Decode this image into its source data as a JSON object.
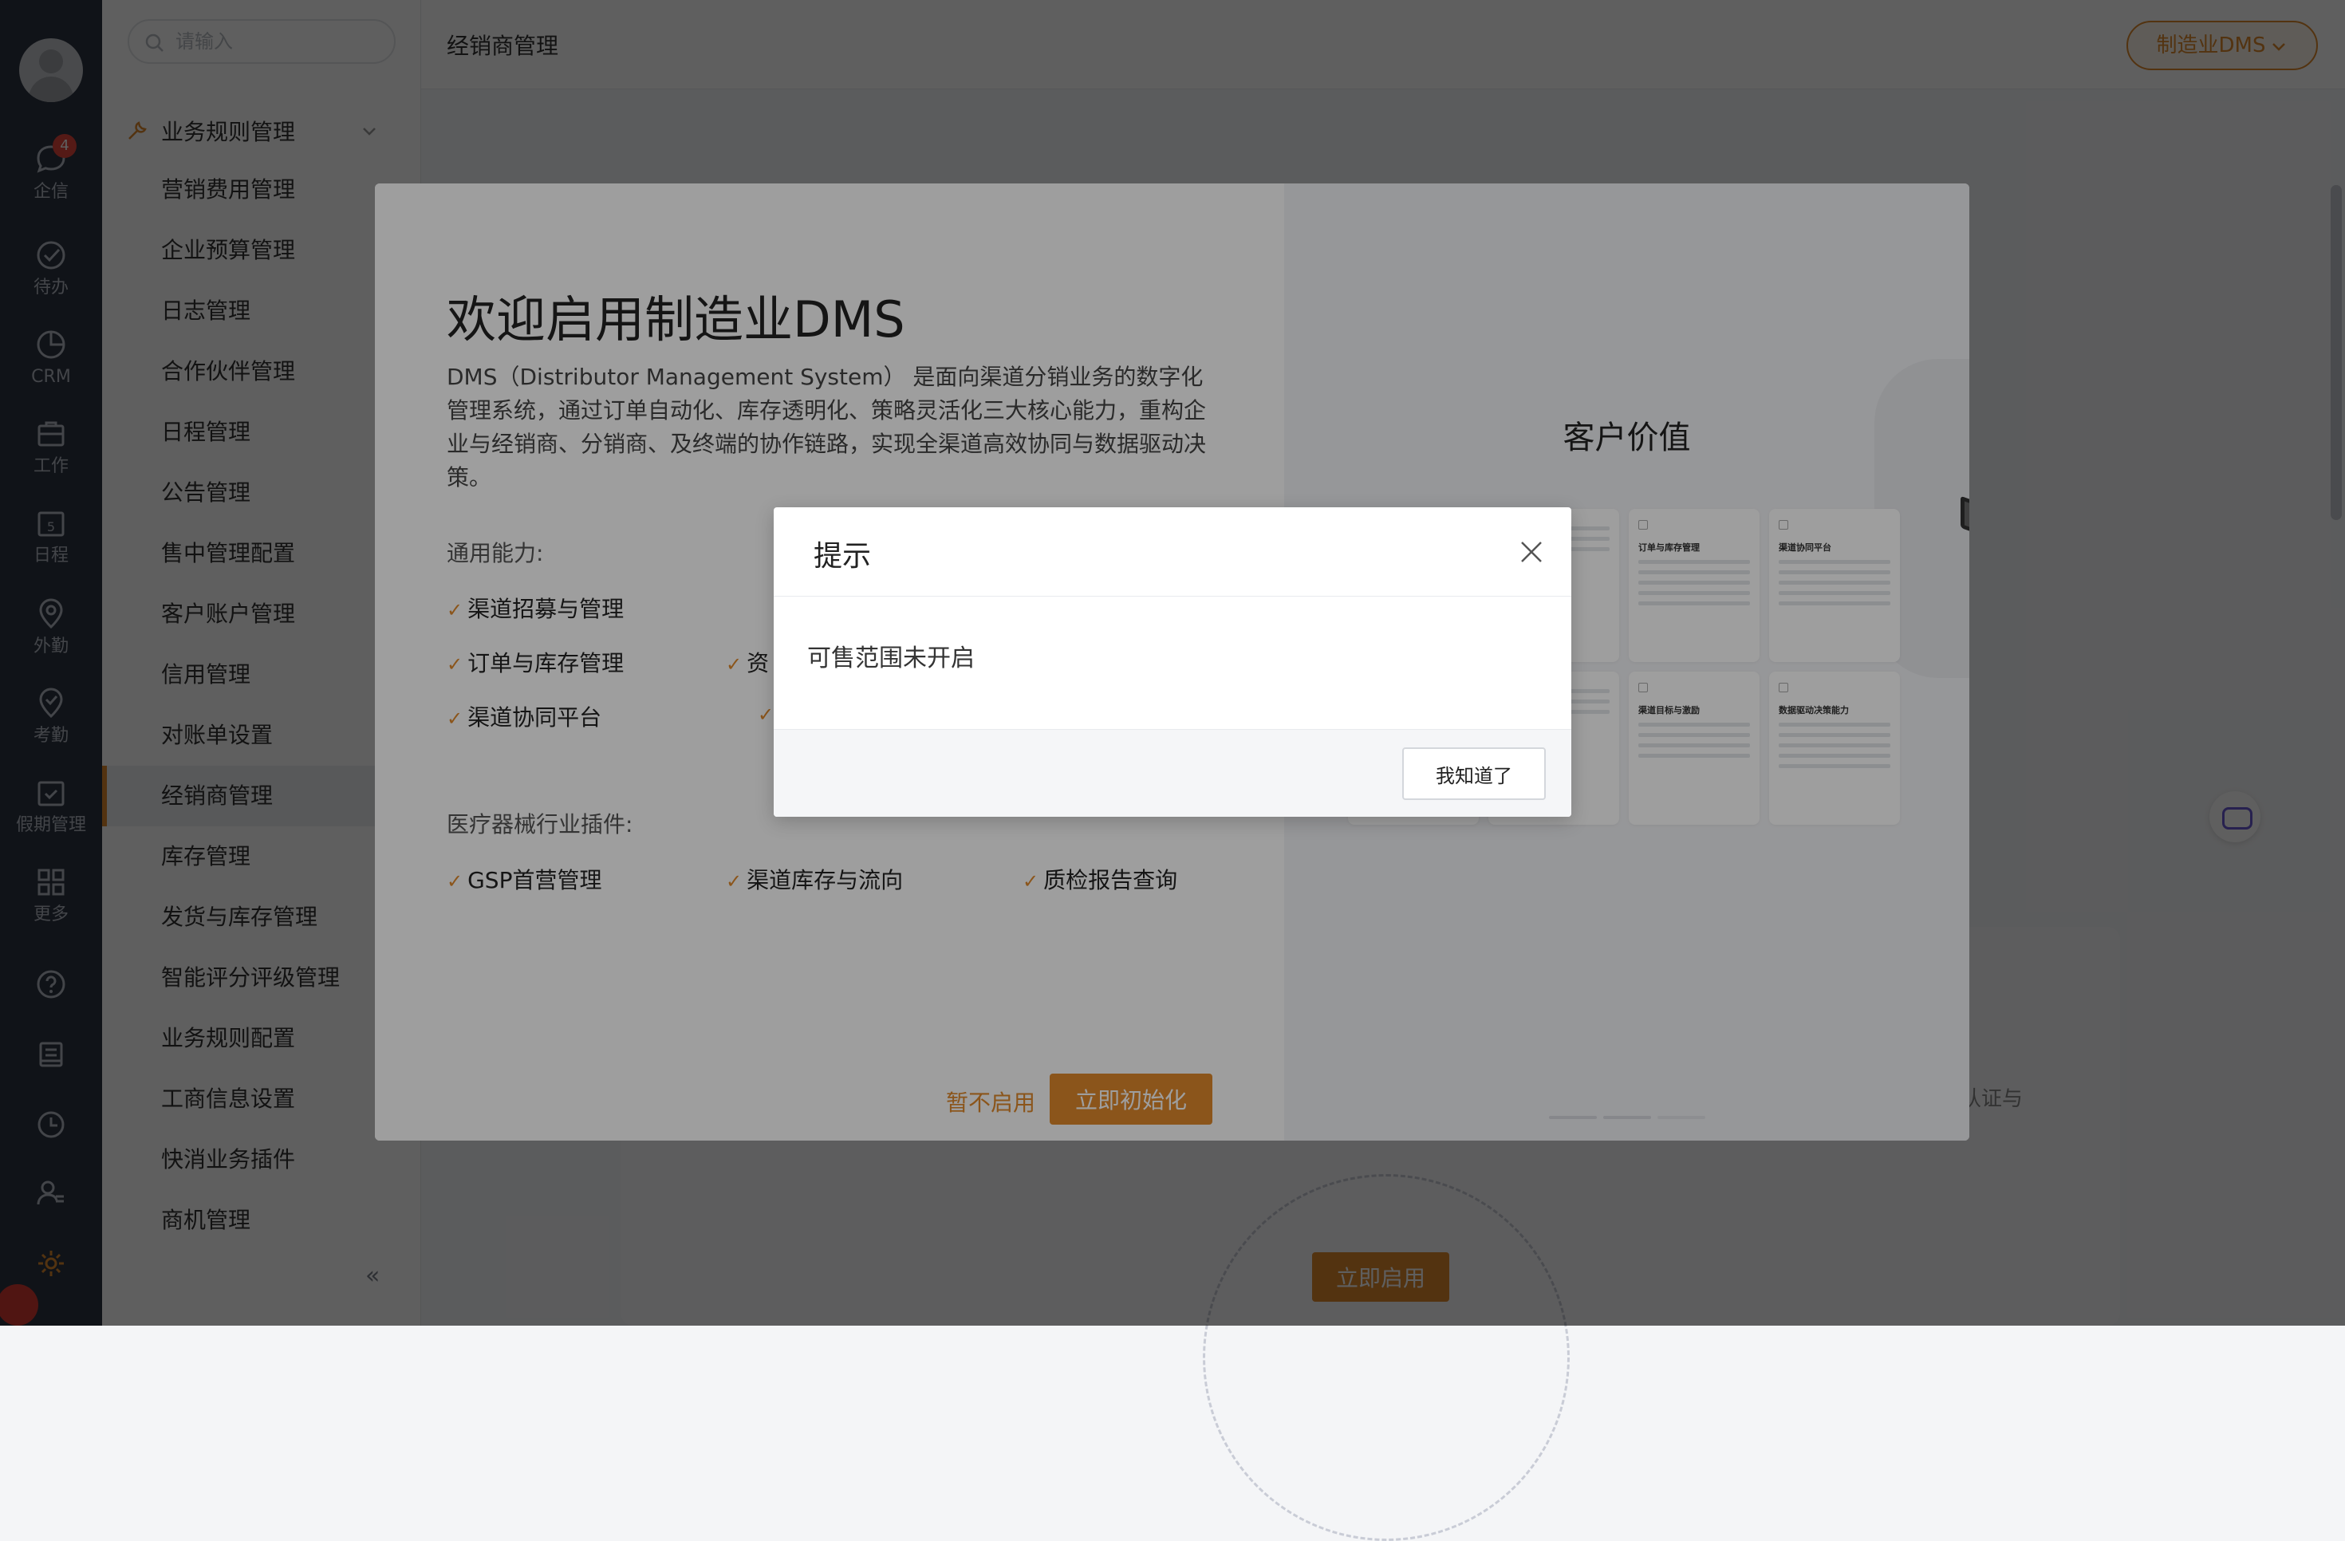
{
  "rail": {
    "items": [
      {
        "label": "企信",
        "badge": "4"
      },
      {
        "label": "待办"
      },
      {
        "label": "CRM"
      },
      {
        "label": "工作"
      },
      {
        "label": "日程",
        "day": "5"
      },
      {
        "label": "外勤"
      },
      {
        "label": "考勤"
      },
      {
        "label": "假期管理"
      },
      {
        "label": "更多"
      }
    ]
  },
  "submenu": {
    "search_placeholder": "请输入",
    "group_label": "业务规则管理",
    "items": [
      "营销费用管理",
      "企业预算管理",
      "日志管理",
      "合作伙伴管理",
      "日程管理",
      "公告管理",
      "售中管理配置",
      "客户账户管理",
      "信用管理",
      "对账单设置",
      "经销商管理",
      "库存管理",
      "发货与库存管理",
      "智能评分评级管理",
      "业务规则配置",
      "工商信息设置",
      "快消业务插件",
      "商机管理"
    ],
    "active": "经销商管理",
    "collapse": "«"
  },
  "header": {
    "title": "经销商管理",
    "product_button": "制造业DMS"
  },
  "background": {
    "button": "立即启用",
    "partial_text": "认证与"
  },
  "welcome": {
    "title": "欢迎启用制造业DMS",
    "description": "DMS（Distributor Management System） 是面向渠道分销业务的数字化管理系统，通过订单自动化、库存透明化、策略灵活化三大核心能力，重构企业与经销商、分销商、及终端的协作链路，实现全渠道高效协同与数据驱动决策。",
    "general_label": "通用能力:",
    "general_features": [
      "渠道招募与管理",
      "订单与库存管理",
      "资",
      "渠道协同平台",
      ""
    ],
    "plugin_label": "医疗器械行业插件:",
    "plugin_features": [
      "GSP首营管理",
      "渠道库存与流向",
      "质检报告查询"
    ],
    "skip": "暂不启用",
    "init": "立即初始化",
    "right_title": "客户价值",
    "cards": [
      "订单与库存管理",
      "渠道协同平台",
      "渠道目标与激励",
      "数据驱动决策能力"
    ]
  },
  "dialog": {
    "title": "提示",
    "message": "可售范围未开启",
    "ok": "我知道了"
  },
  "colors": {
    "accent": "#e08a2c",
    "rail": "#2c3442",
    "badge": "#e6473d"
  }
}
